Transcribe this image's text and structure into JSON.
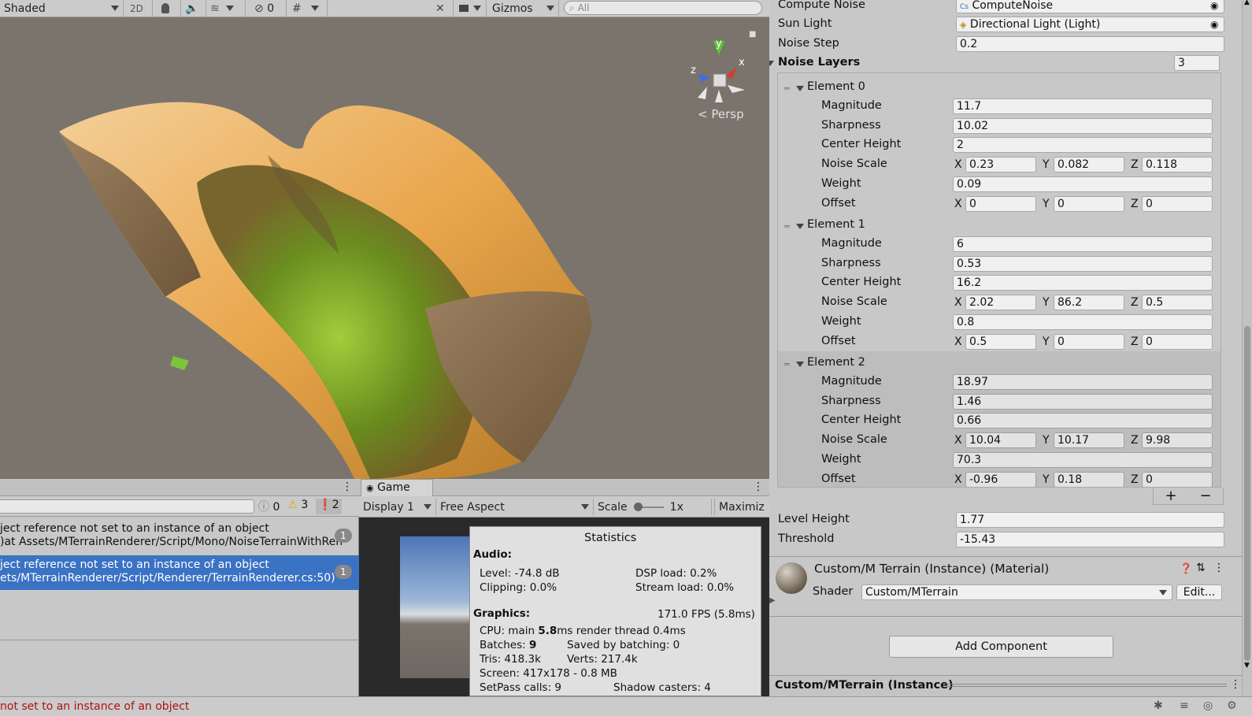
{
  "scene_toolbar": {
    "shading_mode": "Shaded",
    "mode_2d": "2D",
    "hidden_count": "0",
    "gizmos": "Gizmos",
    "search_placeholder": "All",
    "persp_label": "Persp",
    "gizmo_axes": {
      "x": "x",
      "y": "y",
      "z": "z"
    }
  },
  "inspector": {
    "compute_noise_label": "Compute Noise",
    "compute_noise_value": "ComputeNoise",
    "sun_light_label": "Sun Light",
    "sun_light_value": "Directional Light (Light)",
    "noise_step_label": "Noise Step",
    "noise_step_value": "0.2",
    "noise_layers_label": "Noise Layers",
    "noise_layers_count": "3",
    "elements": [
      {
        "title": "Element 0",
        "magnitude": "11.7",
        "sharpness": "10.02",
        "center_height": "2",
        "noise_scale": {
          "x": "0.23",
          "y": "0.082",
          "z": "0.118"
        },
        "weight": "0.09",
        "offset": {
          "x": "0",
          "y": "0",
          "z": "0"
        }
      },
      {
        "title": "Element 1",
        "magnitude": "6",
        "sharpness": "0.53",
        "center_height": "16.2",
        "noise_scale": {
          "x": "2.02",
          "y": "86.2",
          "z": "0.5"
        },
        "weight": "0.8",
        "offset": {
          "x": "0.5",
          "y": "0",
          "z": "0"
        }
      },
      {
        "title": "Element 2",
        "magnitude": "18.97",
        "sharpness": "1.46",
        "center_height": "0.66",
        "noise_scale": {
          "x": "10.04",
          "y": "10.17",
          "z": "9.98"
        },
        "weight": "70.3",
        "offset": {
          "x": "-0.96",
          "y": "0.18",
          "z": "0"
        }
      }
    ],
    "field_labels": {
      "magnitude": "Magnitude",
      "sharpness": "Sharpness",
      "center_height": "Center Height",
      "noise_scale": "Noise Scale",
      "weight": "Weight",
      "offset": "Offset",
      "x": "X",
      "y": "Y",
      "z": "Z"
    },
    "plus": "+",
    "minus": "−",
    "level_height_label": "Level Height",
    "level_height_value": "1.77",
    "threshold_label": "Threshold",
    "threshold_value": "-15.43",
    "material_title": "Custom/M Terrain (Instance) (Material)",
    "shader_label": "Shader",
    "shader_value": "Custom/MTerrain",
    "edit_button": "Edit...",
    "add_component": "Add Component",
    "preview_title": "Custom/MTerrain (Instance)"
  },
  "console": {
    "log_count": "0",
    "warn_count": "3",
    "error_count": "2",
    "entries": [
      {
        "line1": "ject reference not set to an instance of an object",
        "line2": ")at Assets/MTerrainRenderer/Script/Mono/NoiseTerrainWithRen",
        "count": "1",
        "selected": false
      },
      {
        "line1": "ject reference not set to an instance of an object",
        "line2": "ets/MTerrainRenderer/Script/Renderer/TerrainRenderer.cs:50)",
        "count": "1",
        "selected": true
      }
    ]
  },
  "game": {
    "tab": "Game",
    "display": "Display 1",
    "aspect": "Free Aspect",
    "scale_label": "Scale",
    "scale_value": "1x",
    "maximize": "Maximiz",
    "stats": {
      "title": "Statistics",
      "audio_header": "Audio:",
      "level": "Level: -74.8 dB",
      "clipping": "Clipping: 0.0%",
      "dsp": "DSP load: 0.2%",
      "stream": "Stream load: 0.0%",
      "graphics_header": "Graphics:",
      "fps": "171.0 FPS (5.8ms)",
      "cpu_prefix": "CPU: main ",
      "cpu_main": "5.8",
      "cpu_suffix": "ms  render thread 0.4ms",
      "batches_prefix": "Batches: ",
      "batches": "9",
      "saved": "Saved by batching: 0",
      "tris": "Tris: 418.3k",
      "verts": "Verts: 217.4k",
      "screen": "Screen: 417x178 - 0.8 MB",
      "setpass": "SetPass calls: 9",
      "shadow": "Shadow casters: 4"
    }
  },
  "status_bar": {
    "message": "not set to an instance of an object"
  }
}
